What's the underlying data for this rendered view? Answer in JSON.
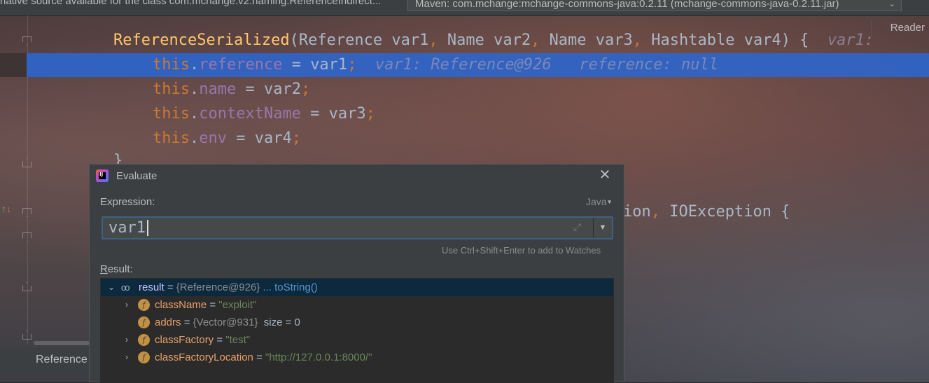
{
  "editor": {
    "notice_text": "native source available for the class com.mchange.v2.naming.ReferenceIndirect...",
    "source_select": "Maven: com.mchange:mchange-commons-java:0.2.11 (mchange-commons-java-0.2.11.jar)",
    "reader_mode": "Reader",
    "bottom_tab": "Reference",
    "code": {
      "line1": {
        "method": "ReferenceSerialized",
        "open": "(",
        "t1": "Reference var1",
        "t2": " Name var2",
        "t3": " Name var3",
        "t4": " Hashtable var4) {",
        "comma": ",",
        "hint": "var1:"
      },
      "line2": {
        "this": "this",
        "dot": ".",
        "field": "reference",
        "rest": " = var1",
        "semi": ";",
        "hint1": "var1: Reference@926",
        "hint2": "reference: null"
      },
      "line3": {
        "this": "this",
        "dot": ".",
        "field": "name",
        "rest": " = var2",
        "semi": ";"
      },
      "line4": {
        "this": "this",
        "dot": ".",
        "field": "contextName",
        "rest": " = var3",
        "semi": ";"
      },
      "line5": {
        "this": "this",
        "dot": ".",
        "field": "env",
        "rest": " = var4",
        "semi": ";"
      },
      "line6": "}",
      "line7": {
        "a": "ion",
        "comma": ",",
        "b": " IOException {"
      }
    }
  },
  "dialog": {
    "title": "Evaluate",
    "close_label": "✕",
    "expression_label": "Expression:",
    "language": "Java",
    "expression_value": "var1",
    "watch_hint": "Use Ctrl+Shift+Enter to add to Watches",
    "result_label_first": "R",
    "result_label_rest": "esult:",
    "result": {
      "name": "result",
      "eq": " = ",
      "ref": "{Reference@926}",
      "link": " ... toString()",
      "children": [
        {
          "name": "className",
          "eq": " = ",
          "value": "\"exploit\""
        },
        {
          "name": "addrs",
          "eq": " = ",
          "ref": "{Vector@931}",
          "extra": "  size = 0"
        },
        {
          "name": "classFactory",
          "eq": " = ",
          "value": "\"test\""
        },
        {
          "name": "classFactoryLocation",
          "eq": " = ",
          "value": "\"http://127.0.0.1:8000/\""
        }
      ]
    }
  },
  "colors": {
    "keyword": "#cc7832",
    "method": "#ffc66d",
    "field": "#9876aa",
    "string": "#6a8759",
    "selection": "#2f65ca"
  }
}
